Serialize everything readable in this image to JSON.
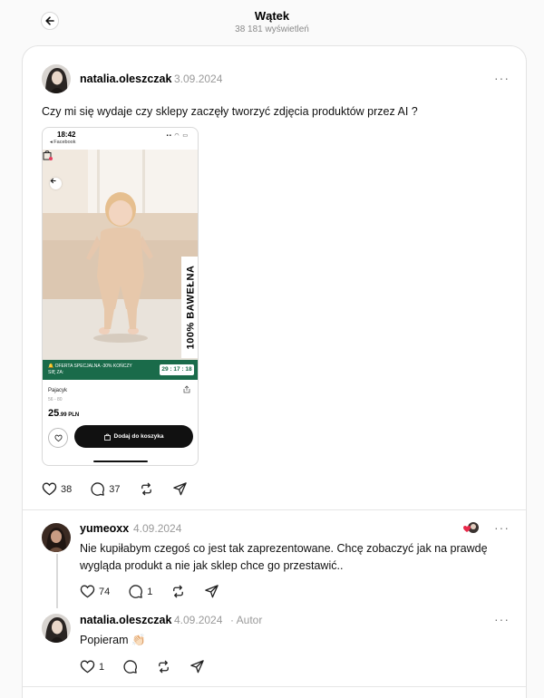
{
  "header": {
    "title": "Wątek",
    "views": "38 181 wyświetleń"
  },
  "post": {
    "username": "natalia.oleszczak",
    "date": "3.09.2024",
    "text": "Czy mi się wydaje czy sklepy zaczęły tworzyć zdjęcia produktów przez AI ?",
    "likes": "38",
    "comments": "37",
    "image": {
      "status_time": "18:42",
      "back_app": "◂ Facebook",
      "badge_text": "100% BAWEŁNA",
      "promo_text": "🔔 OFERTA SPECJALNA -30% KOŃCZY SIĘ ZA:",
      "timer": "29 : 17 : 18",
      "product_name": "Pajacyk",
      "size": "56 - 80",
      "price_main": "25",
      "price_suffix": ".99 PLN",
      "cart_button": "Dodaj do koszyka"
    }
  },
  "replies": [
    {
      "username": "yumeoxx",
      "date": "4.09.2024",
      "text_line1": "Nie kupiłabym czegoś co jest tak zaprezentowane. Chcę zobaczyć jak na prawdę",
      "text_line2": "wygląda produkt a nie jak sklep chce go przestawić..",
      "likes": "74",
      "comments": "1"
    },
    {
      "username": "natalia.oleszczak",
      "date": "4.09.2024",
      "author_label": "· Autor",
      "text": "Popieram 👏🏻",
      "likes": "1"
    }
  ],
  "icons": {
    "more": "···"
  }
}
